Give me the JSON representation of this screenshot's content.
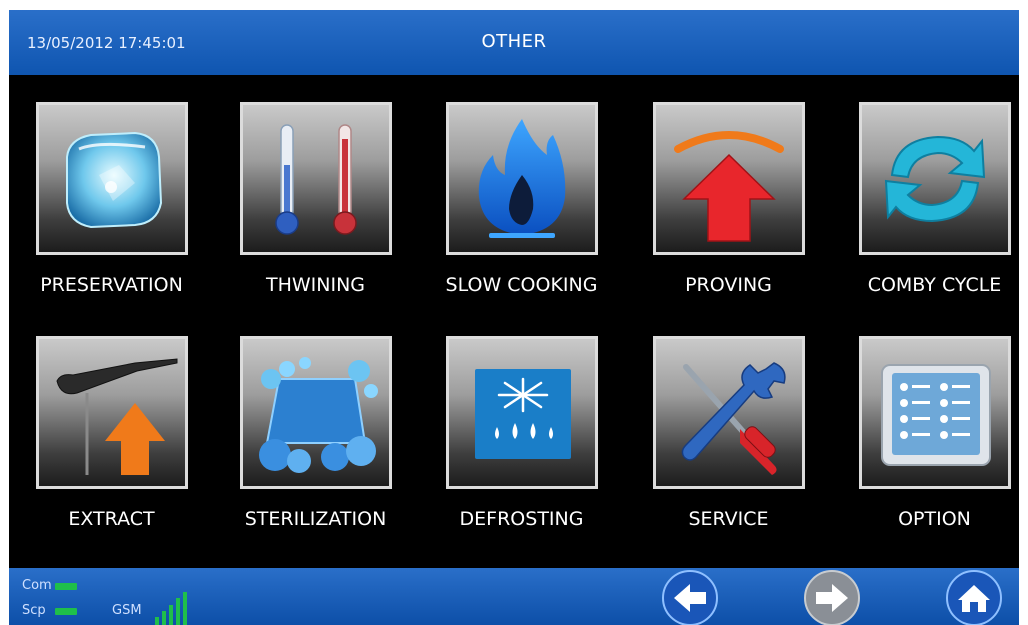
{
  "header": {
    "datetime": "13/05/2012 17:45:01",
    "title": "OTHER"
  },
  "menu": [
    {
      "label": "PRESERVATION",
      "icon": "ice-cube-icon"
    },
    {
      "label": "THWINING",
      "icon": "thermometers-icon"
    },
    {
      "label": "SLOW COOKING",
      "icon": "flame-icon"
    },
    {
      "label": "PROVING",
      "icon": "proving-arrow-icon"
    },
    {
      "label": "COMBY CYCLE",
      "icon": "cycle-arrows-icon"
    },
    {
      "label": "EXTRACT",
      "icon": "probe-extract-icon"
    },
    {
      "label": "STERILIZATION",
      "icon": "sterilization-bubbles-icon"
    },
    {
      "label": "DEFROSTING",
      "icon": "snowflake-drops-icon"
    },
    {
      "label": "SERVICE",
      "icon": "tools-icon"
    },
    {
      "label": "OPTION",
      "icon": "option-panel-icon"
    }
  ],
  "status": {
    "com_label": "Com",
    "scp_label": "Scp",
    "gsm_label": "GSM"
  },
  "nav": {
    "back_icon": "arrow-left-icon",
    "forward_icon": "arrow-right-icon",
    "home_icon": "home-icon"
  },
  "colors": {
    "header_blue": "#1a60bd",
    "status_green": "#1fbf4a",
    "tile_border": "#dcdcdc"
  }
}
